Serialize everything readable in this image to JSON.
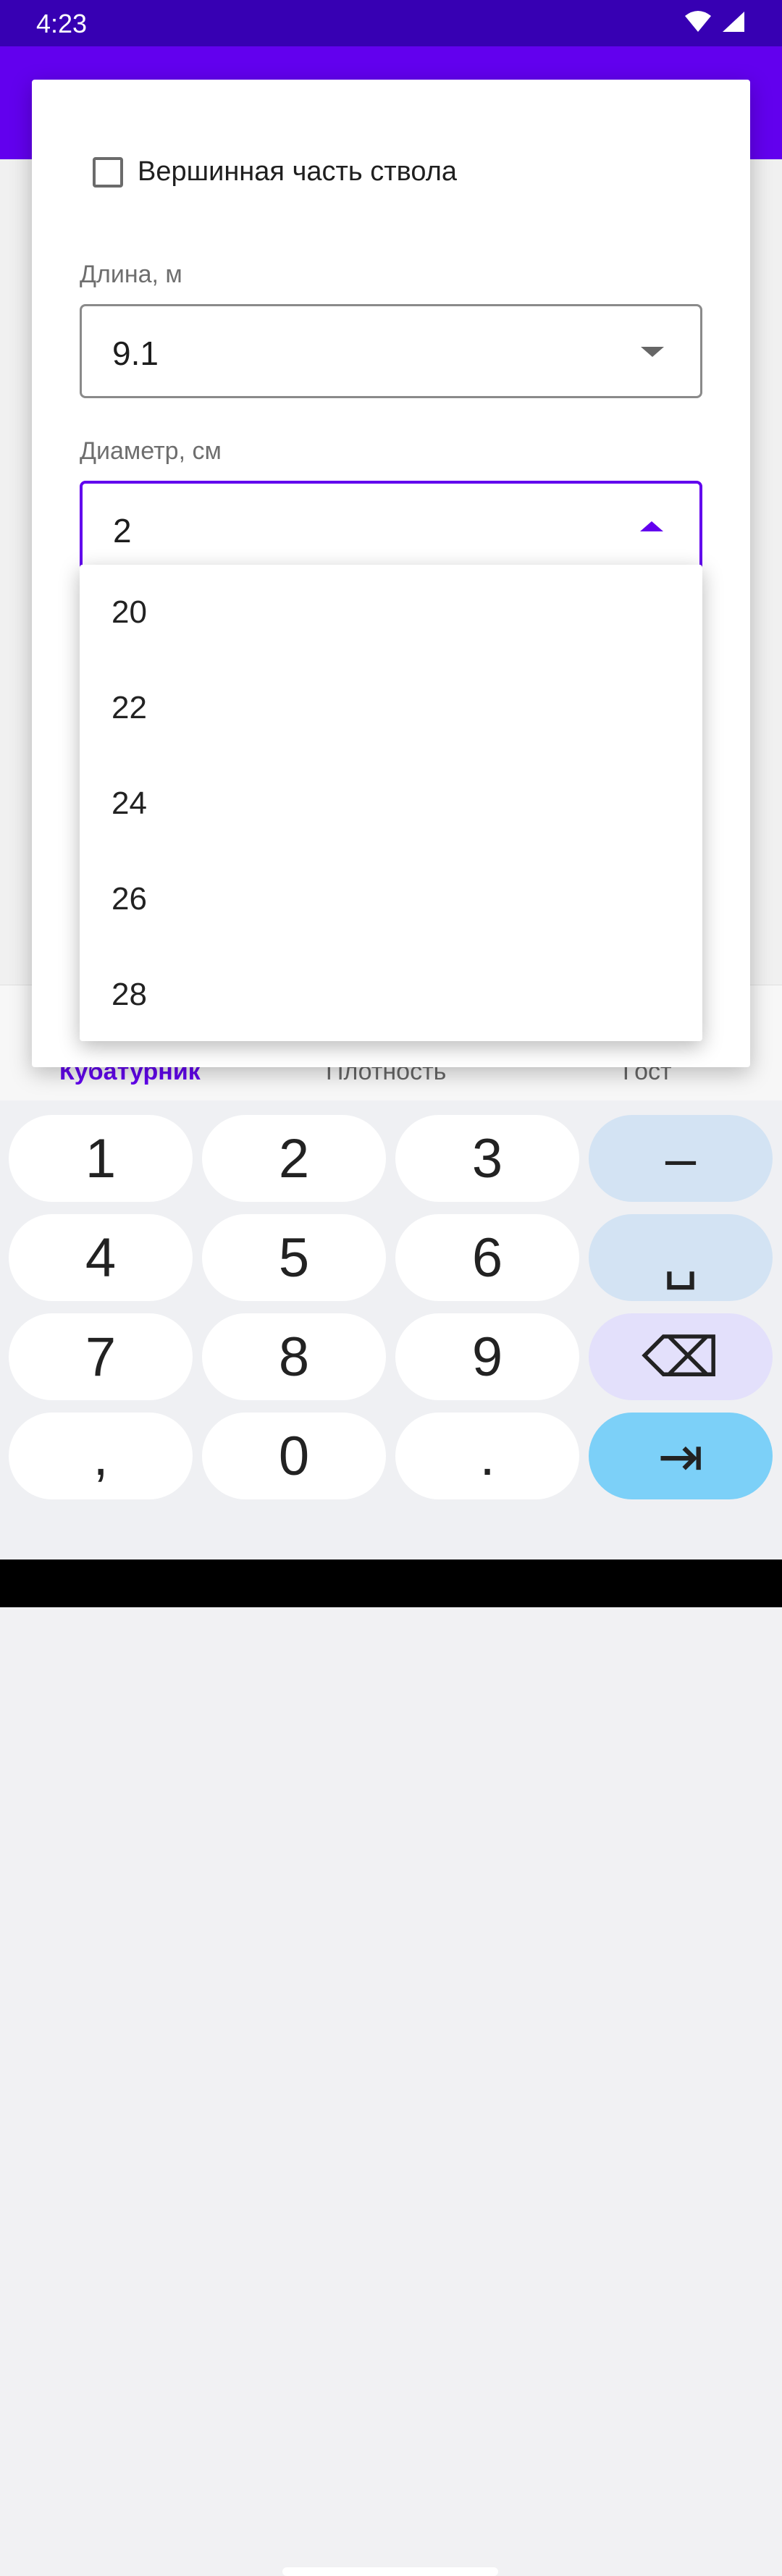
{
  "status": {
    "time": "4:23",
    "wifi_icon": "wifi-icon",
    "signal_icon": "signal-icon"
  },
  "dialog": {
    "checkbox_label": "Вершинная часть ствола",
    "length_label": "Длина, м",
    "length_value": "9.1",
    "diameter_label": "Диаметр, см",
    "diameter_value": "2"
  },
  "dropdown": {
    "options": [
      "20",
      "22",
      "24",
      "26",
      "28"
    ]
  },
  "bottom_nav": {
    "tabs": [
      "Кубатурник",
      "Плотность",
      "Гост"
    ],
    "active": "Кубатурник"
  },
  "keyboard": {
    "keys": [
      "1",
      "2",
      "3",
      "–",
      "4",
      "5",
      "6",
      "␣",
      "7",
      "8",
      "9",
      "⌫",
      ",",
      "0",
      ".",
      "⇥"
    ]
  },
  "colors": {
    "primary": "#6200ee",
    "primary_dark": "#3700b3"
  }
}
